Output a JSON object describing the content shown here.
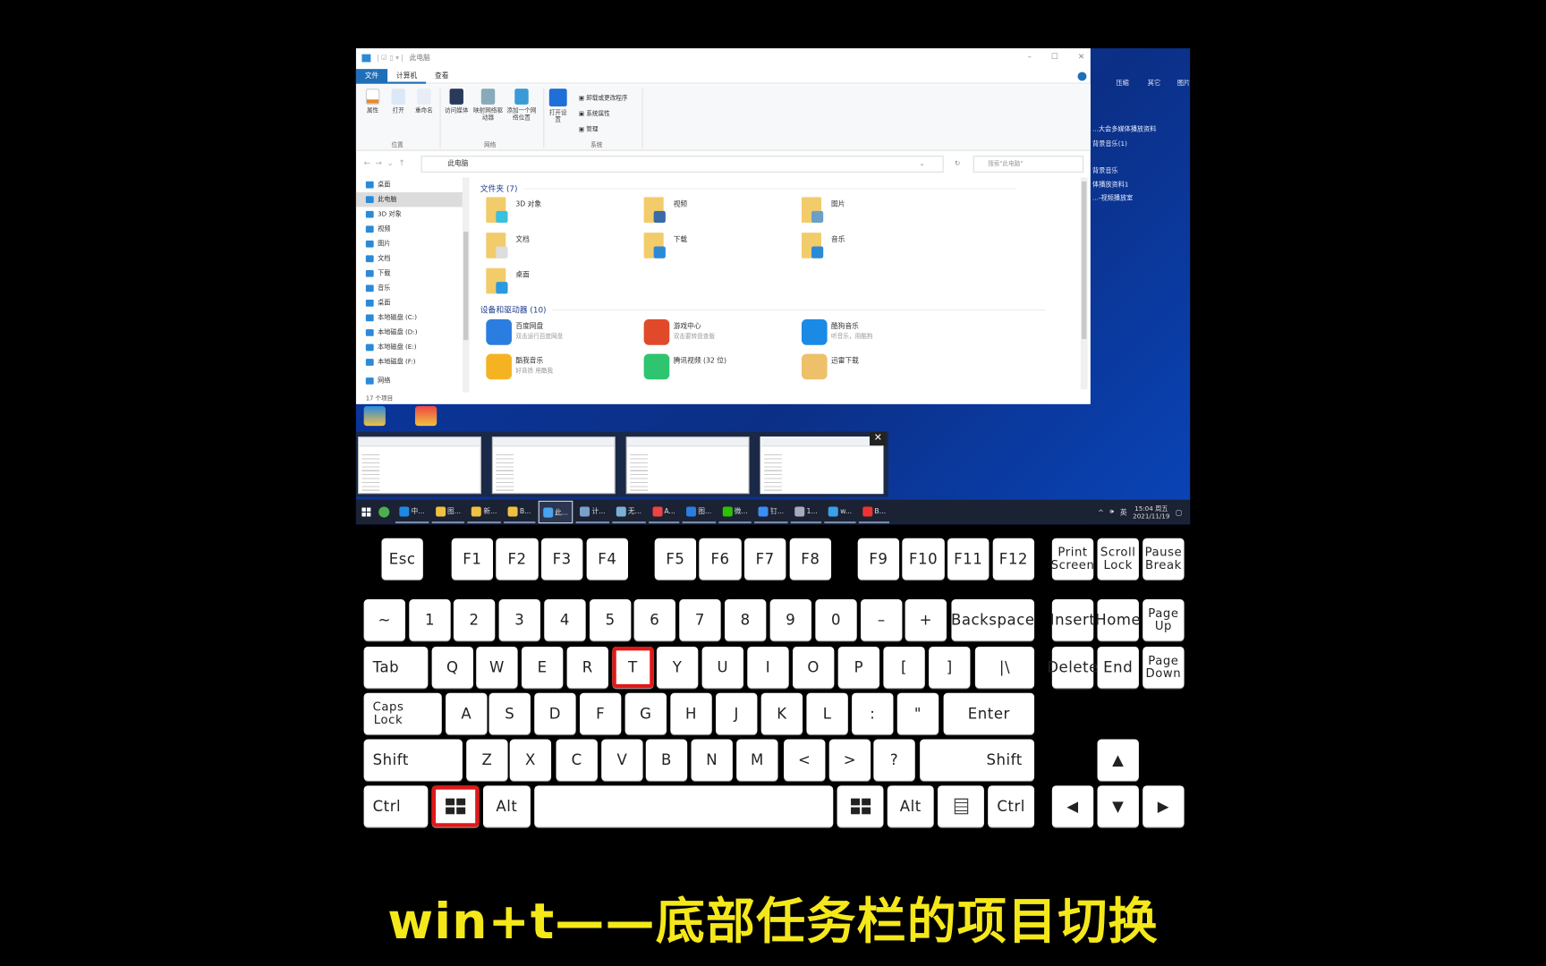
{
  "explorer": {
    "title": "此电脑",
    "window_controls": [
      "–",
      "☐",
      "✕"
    ],
    "tabs": [
      "文件",
      "计算机",
      "查看"
    ],
    "ribbon": {
      "location": {
        "label": "位置",
        "buttons": [
          "属性",
          "打开",
          "重命名"
        ]
      },
      "network": {
        "label": "网络",
        "buttons": [
          "访问媒体",
          "映射网络驱动器",
          "添加一个网络位置"
        ]
      },
      "system": {
        "label": "系统",
        "open_settings": "打开设置",
        "items": [
          "卸载或更改程序",
          "系统属性",
          "管理"
        ]
      }
    },
    "address": "此电脑",
    "search_placeholder": "搜索\"此电脑\"",
    "nav": [
      "桌面",
      "此电脑",
      "3D 对象",
      "视频",
      "图片",
      "文档",
      "下载",
      "音乐",
      "桌面",
      "本地磁盘 (C:)",
      "本地磁盘 (D:)",
      "本地磁盘 (E:)",
      "本地磁盘 (F:)",
      "网络"
    ],
    "folders_header": "文件夹 (7)",
    "folders": [
      "3D 对象",
      "视频",
      "图片",
      "文档",
      "下载",
      "音乐",
      "桌面"
    ],
    "devices_header": "设备和驱动器 (10)",
    "devices": [
      {
        "name": "百度网盘",
        "sub": "双击运行百度网盘",
        "color": "#2b7de0"
      },
      {
        "name": "游戏中心",
        "sub": "双击要转盘查版",
        "color": "#e04a2a"
      },
      {
        "name": "酷狗音乐",
        "sub": "听音乐，用酷狗",
        "color": "#1a8ae6"
      },
      {
        "name": "酷我音乐",
        "sub": "好音质 用酷我",
        "color": "#f5b323"
      },
      {
        "name": "腾讯视频 (32 位)",
        "sub": "",
        "color": "#2fc46f"
      },
      {
        "name": "迅雷下载",
        "sub": "",
        "color": "#eec06a"
      }
    ],
    "status": "17 个项目"
  },
  "desktop": {
    "ribbon_labels": [
      "压缩",
      "其它",
      "图片"
    ],
    "file_lines": [
      "...大会多媒体播放资料",
      "背景音乐(1)",
      "背景音乐",
      "体播放资料1",
      "...-视频播放室"
    ]
  },
  "taskbar": {
    "items": [
      {
        "label": "中...",
        "color": "#1e88e5"
      },
      {
        "label": "图...",
        "color": "#f0c040"
      },
      {
        "label": "新...",
        "color": "#f0c040"
      },
      {
        "label": "B...",
        "color": "#f0c040"
      },
      {
        "label": "此...",
        "color": "#4aa3ef",
        "active": true
      },
      {
        "label": "计...",
        "color": "#7aa0c8"
      },
      {
        "label": "无...",
        "color": "#7ab0d8"
      },
      {
        "label": "A...",
        "color": "#e44"
      },
      {
        "label": "图...",
        "color": "#2a7de1"
      },
      {
        "label": "微...",
        "color": "#2dc100"
      },
      {
        "label": "钉...",
        "color": "#3a8ef6"
      },
      {
        "label": "1...",
        "color": "#aab"
      },
      {
        "label": "w...",
        "color": "#3aa0e8"
      },
      {
        "label": "B...",
        "color": "#e33"
      }
    ],
    "ime": "英",
    "time": "15:04 周五",
    "date": "2021/11/19"
  },
  "keyboard": {
    "highlight_color": "#e01818",
    "rows": [
      [
        "Esc",
        "F1",
        "F2",
        "F3",
        "F4",
        "F5",
        "F6",
        "F7",
        "F8",
        "F9",
        "F10",
        "F11",
        "F12",
        "Print Screen",
        "Scroll Lock",
        "Pause Break"
      ],
      [
        "~",
        "1",
        "2",
        "3",
        "4",
        "5",
        "6",
        "7",
        "8",
        "9",
        "0",
        "–",
        "+",
        "Backspace",
        "Insert",
        "Home",
        "Page Up"
      ],
      [
        "Tab",
        "Q",
        "W",
        "E",
        "R",
        "T",
        "Y",
        "U",
        "I",
        "O",
        "P",
        "[",
        "]",
        "|\\",
        "Delete",
        "End",
        "Page Down"
      ],
      [
        "Caps Lock",
        "A",
        "S",
        "D",
        "F",
        "G",
        "H",
        "J",
        "K",
        "L",
        ":",
        "\"",
        "Enter"
      ],
      [
        "Shift",
        "Z",
        "X",
        "C",
        "V",
        "B",
        "N",
        "M",
        "<",
        ">",
        "?",
        "Shift",
        "▲"
      ],
      [
        "Ctrl",
        "win",
        "Alt",
        "",
        "win",
        "Alt",
        "menu",
        "Ctrl",
        "◀",
        "▼",
        "▶"
      ]
    ],
    "pressed": [
      "T",
      "win-left"
    ]
  },
  "caption": "win+t——底部任务栏的项目切换"
}
